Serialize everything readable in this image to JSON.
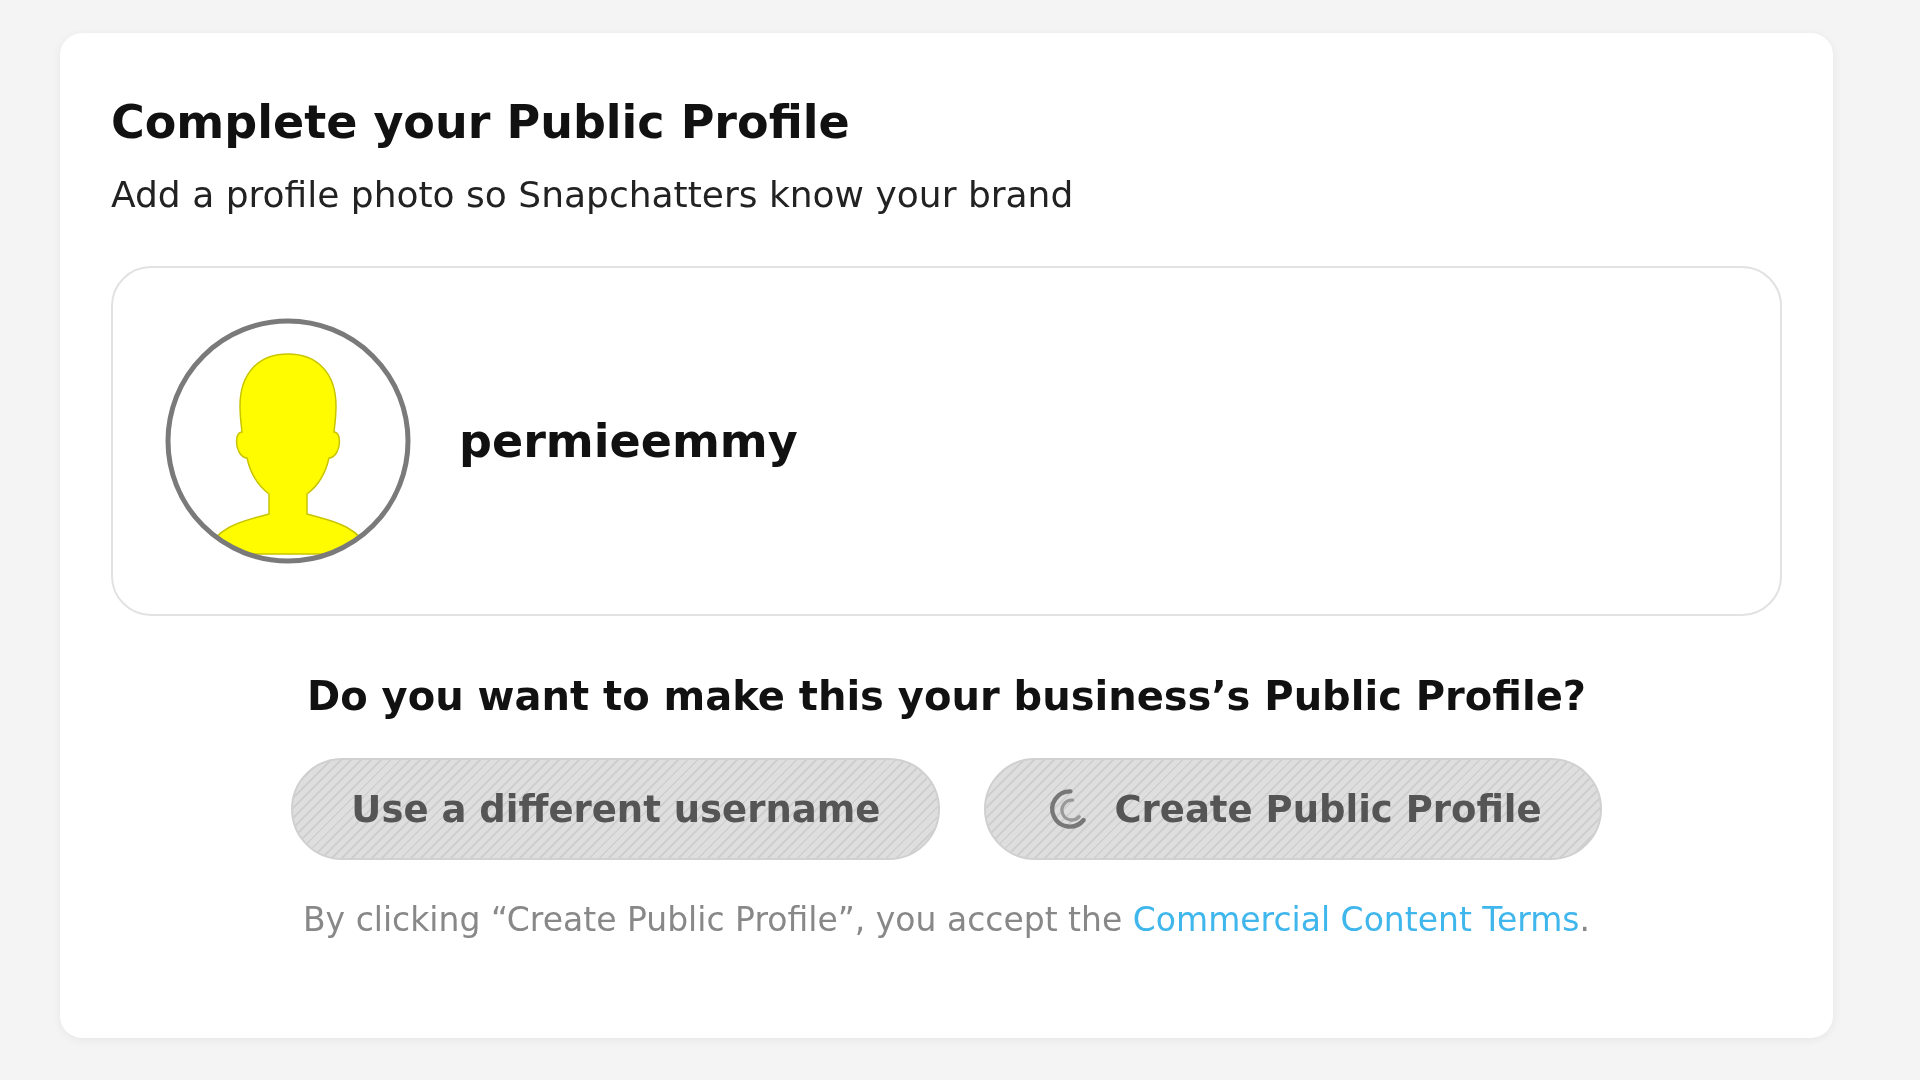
{
  "card": {
    "title": "Complete your Public Profile",
    "subtitle": "Add a profile photo so Snapchatters know your brand"
  },
  "profile": {
    "username": "permieemmy"
  },
  "question": "Do you want to make this your business’s Public Profile?",
  "buttons": [
    {
      "label": "Use a different username",
      "disabled": true,
      "loading": false
    },
    {
      "label": "Create Public Profile",
      "disabled": true,
      "loading": true
    }
  ],
  "footer": {
    "text": "By clicking “Create Public Profile”, you accept the ",
    "link": "Commercial Content Terms",
    "end": "."
  }
}
